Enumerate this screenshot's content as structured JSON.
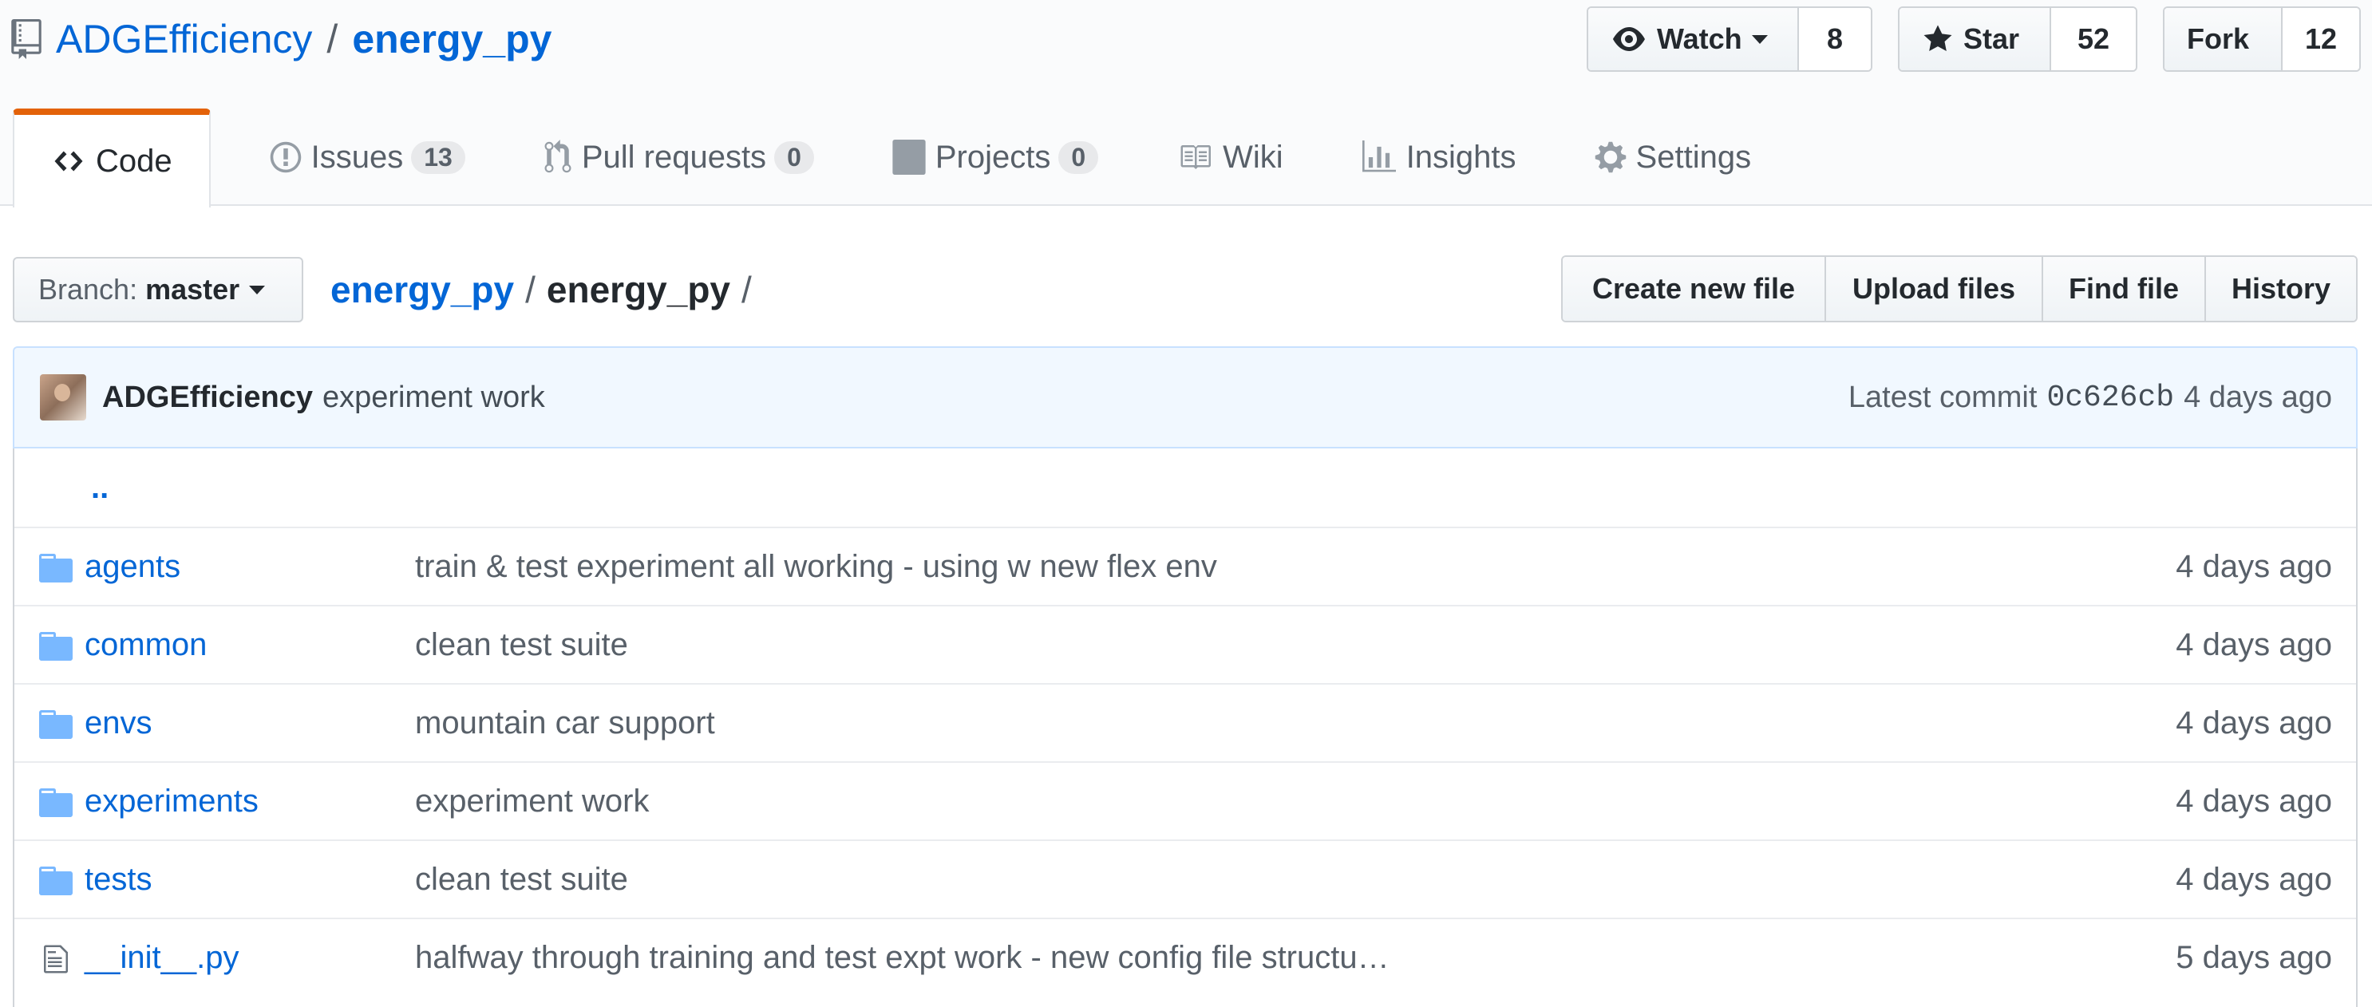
{
  "repo": {
    "owner": "ADGEfficiency",
    "separator": "/",
    "name": "energy_py"
  },
  "actions": {
    "watch": {
      "label": "Watch",
      "count": "8"
    },
    "star": {
      "label": "Star",
      "count": "52"
    },
    "fork": {
      "label": "Fork",
      "count": "12"
    }
  },
  "tabs": [
    {
      "label": "Code",
      "icon": "code-icon",
      "selected": true
    },
    {
      "label": "Issues",
      "count": "13",
      "icon": "issue-icon"
    },
    {
      "label": "Pull requests",
      "count": "0",
      "icon": "pull-request-icon"
    },
    {
      "label": "Projects",
      "count": "0",
      "icon": "project-icon"
    },
    {
      "label": "Wiki",
      "icon": "book-icon"
    },
    {
      "label": "Insights",
      "icon": "graph-icon"
    },
    {
      "label": "Settings",
      "icon": "gear-icon"
    }
  ],
  "branch": {
    "prefix": "Branch:",
    "name": "master"
  },
  "breadcrumb": {
    "root": "energy_py",
    "separator": "/",
    "current": "energy_py",
    "trailing": "/"
  },
  "file_actions": [
    "Create new file",
    "Upload files",
    "Find file",
    "History"
  ],
  "commit": {
    "author": "ADGEfficiency",
    "message": "experiment work",
    "prefix": "Latest commit",
    "sha": "0c626cb",
    "age": "4 days ago"
  },
  "files": {
    "parent": "..",
    "rows": [
      {
        "type": "dir",
        "name": "agents",
        "message": "train & test experiment all working - using w new flex env",
        "age": "4 days ago"
      },
      {
        "type": "dir",
        "name": "common",
        "message": "clean test suite",
        "age": "4 days ago"
      },
      {
        "type": "dir",
        "name": "envs",
        "message": "mountain car support",
        "age": "4 days ago"
      },
      {
        "type": "dir",
        "name": "experiments",
        "message": "experiment work",
        "age": "4 days ago"
      },
      {
        "type": "dir",
        "name": "tests",
        "message": "clean test suite",
        "age": "4 days ago"
      },
      {
        "type": "file",
        "name": "__init__.py",
        "message": "halfway through training and test expt work - new config file structu…",
        "age": "5 days ago"
      }
    ]
  },
  "colors": {
    "link": "#0366d6",
    "selected_tab_border": "#e36209",
    "commit_bg": "#f1f8ff",
    "folder": "#79b8ff"
  }
}
